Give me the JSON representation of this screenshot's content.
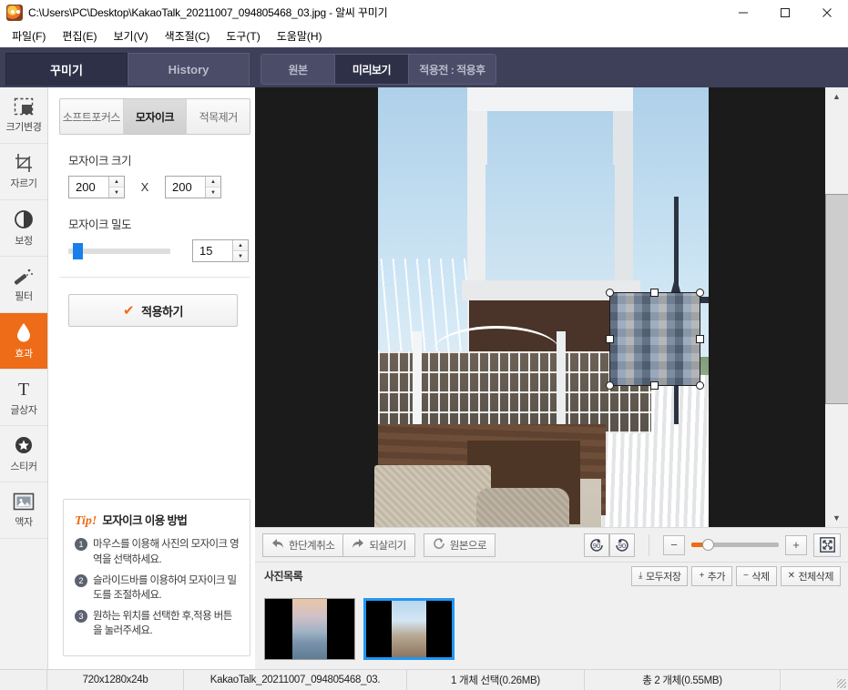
{
  "window": {
    "title": "C:\\Users\\PC\\Desktop\\KakaoTalk_20211007_094805468_03.jpg - 알씨 꾸미기",
    "minimize": "—",
    "maximize": "□",
    "close": "✕"
  },
  "menu": {
    "items": [
      {
        "label": "파일(F)"
      },
      {
        "label": "편집(E)"
      },
      {
        "label": "보기(V)"
      },
      {
        "label": "색조절(C)"
      },
      {
        "label": "도구(T)"
      },
      {
        "label": "도움말(H)"
      }
    ]
  },
  "left_tabs": [
    {
      "label": "꾸미기",
      "active": true
    },
    {
      "label": "History",
      "active": false
    }
  ],
  "toolrail": {
    "items": [
      {
        "label": "크기변경",
        "icon": "resize-icon",
        "active": false
      },
      {
        "label": "자르기",
        "icon": "crop-icon",
        "active": false
      },
      {
        "label": "보정",
        "icon": "adjust-icon",
        "active": false
      },
      {
        "label": "필터",
        "icon": "filter-wand-icon",
        "active": false
      },
      {
        "label": "효과",
        "icon": "effect-drop-icon",
        "active": true
      },
      {
        "label": "글상자",
        "icon": "text-box-icon",
        "active": false
      },
      {
        "label": "스티커",
        "icon": "sticker-star-icon",
        "active": false
      },
      {
        "label": "액자",
        "icon": "frame-photo-icon",
        "active": false
      }
    ]
  },
  "effect_panel": {
    "segments": [
      {
        "label": "소프트포커스",
        "active": false
      },
      {
        "label": "모자이크",
        "active": true
      },
      {
        "label": "적목제거",
        "active": false
      }
    ],
    "size_label": "모자이크 크기",
    "size_width": "200",
    "size_separator": "X",
    "size_height": "200",
    "density_label": "모자이크 밀도",
    "density_value": "15",
    "apply_label": "적용하기",
    "apply_check": "✔"
  },
  "tip": {
    "word": "Tip!",
    "title": "모자이크 이용 방법",
    "steps": [
      {
        "num": "1",
        "text": "마우스를 이용해 사진의 모자이크 영역을 선택하세요."
      },
      {
        "num": "2",
        "text": "슬라이드바를 이용하여 모자이크 밀도를 조절하세요."
      },
      {
        "num": "3",
        "text": "원하는 위치를 선택한 후,적용 버튼을 눌러주세요."
      }
    ]
  },
  "view_tabs": [
    {
      "label": "원본",
      "active": false
    },
    {
      "label": "미리보기",
      "active": true
    },
    {
      "label": "적용전 : 적용후",
      "active": false
    }
  ],
  "bottom_toolbar": {
    "undo": "한단계취소",
    "redo": "되살리기",
    "reset": "원본으로",
    "rotate_left": "90",
    "rotate_right": "90",
    "zoom_out": "−",
    "zoom_in": "+",
    "fit_label": "fit-to-screen-icon"
  },
  "photo_list": {
    "title": "사진목록",
    "actions": [
      {
        "label": "모두저장",
        "glyph": "⤓",
        "name": "save-all-button"
      },
      {
        "label": "추가",
        "glyph": "+",
        "name": "add-button"
      },
      {
        "label": "삭제",
        "glyph": "−",
        "name": "delete-button"
      },
      {
        "label": "전체삭제",
        "glyph": "✕",
        "name": "delete-all-button"
      }
    ],
    "thumbnails": [
      {
        "name": "thumbnail-1",
        "selected": false
      },
      {
        "name": "thumbnail-2",
        "selected": true
      }
    ]
  },
  "status_bar": {
    "dimensions": "720x1280x24b",
    "filename": "KakaoTalk_20211007_094805468_03.",
    "selection": "1 개체 선택(0.26MB)",
    "total": "총 2 개체(0.55MB)"
  },
  "colors": {
    "accent_orange": "#ee6b17",
    "tabbar_navy": "#3e4059",
    "tab_active_navy": "#2e3048",
    "selection_blue": "#2196f3",
    "slider_blue": "#1a7fe8"
  }
}
